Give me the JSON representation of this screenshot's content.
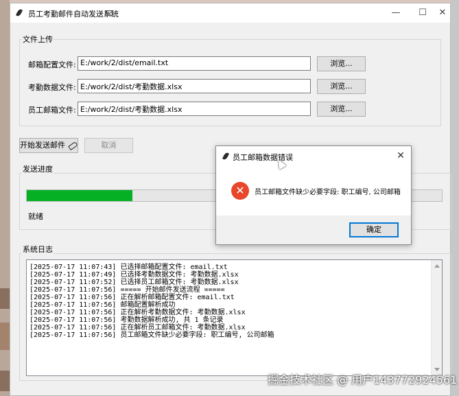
{
  "window": {
    "title": "员工考勤邮件自动发送系统",
    "minimize": "—",
    "maximize": "☐",
    "close": "✕"
  },
  "upload": {
    "group_label": "文件上传",
    "rows": [
      {
        "label": "邮箱配置文件:",
        "value": "E:/work/2/dist/email.txt",
        "browse": "浏览..."
      },
      {
        "label": "考勤数据文件:",
        "value": "E:/work/2/dist/考勤数据.xlsx",
        "browse": "浏览..."
      },
      {
        "label": "员工邮箱文件:",
        "value": "E:/work/2/dist/考勤数据.xlsx",
        "browse": "浏览..."
      }
    ]
  },
  "actions": {
    "start": "开始发送邮件",
    "cancel": "取消"
  },
  "progress": {
    "group_label": "发送进度",
    "fraction": 0.255,
    "status": "就绪",
    "fill_color": "#06b025"
  },
  "log": {
    "group_label": "系统日志",
    "lines": [
      "[2025-07-17 11:07:43] 已选择邮箱配置文件: email.txt",
      "[2025-07-17 11:07:49] 已选择考勤数据文件: 考勤数据.xlsx",
      "[2025-07-17 11:07:52] 已选择员工邮箱文件: 考勤数据.xlsx",
      "[2025-07-17 11:07:56] ===== 开始邮件发送流程 =====",
      "[2025-07-17 11:07:56] 正在解析邮箱配置文件: email.txt",
      "[2025-07-17 11:07:56] 邮箱配置解析成功",
      "[2025-07-17 11:07:56] 正在解析考勤数据文件: 考勤数据.xlsx",
      "[2025-07-17 11:07:56] 考勤数据解析成功, 共 1 条记录",
      "[2025-07-17 11:07:56] 正在解析员工邮箱文件: 考勤数据.xlsx",
      "[2025-07-17 11:07:56] 员工邮箱文件缺少必要字段: 职工编号, 公司邮箱"
    ]
  },
  "dialog": {
    "title": "员工邮箱数据错误",
    "close": "✕",
    "icon": "error-icon",
    "icon_glyph": "✕",
    "icon_color": "#e8472b",
    "message": "员工邮箱文件缺少必要字段: 职工编号, 公司邮箱",
    "ok": "确定"
  },
  "watermark": "掘金技术社区 @ 用户143772924561"
}
